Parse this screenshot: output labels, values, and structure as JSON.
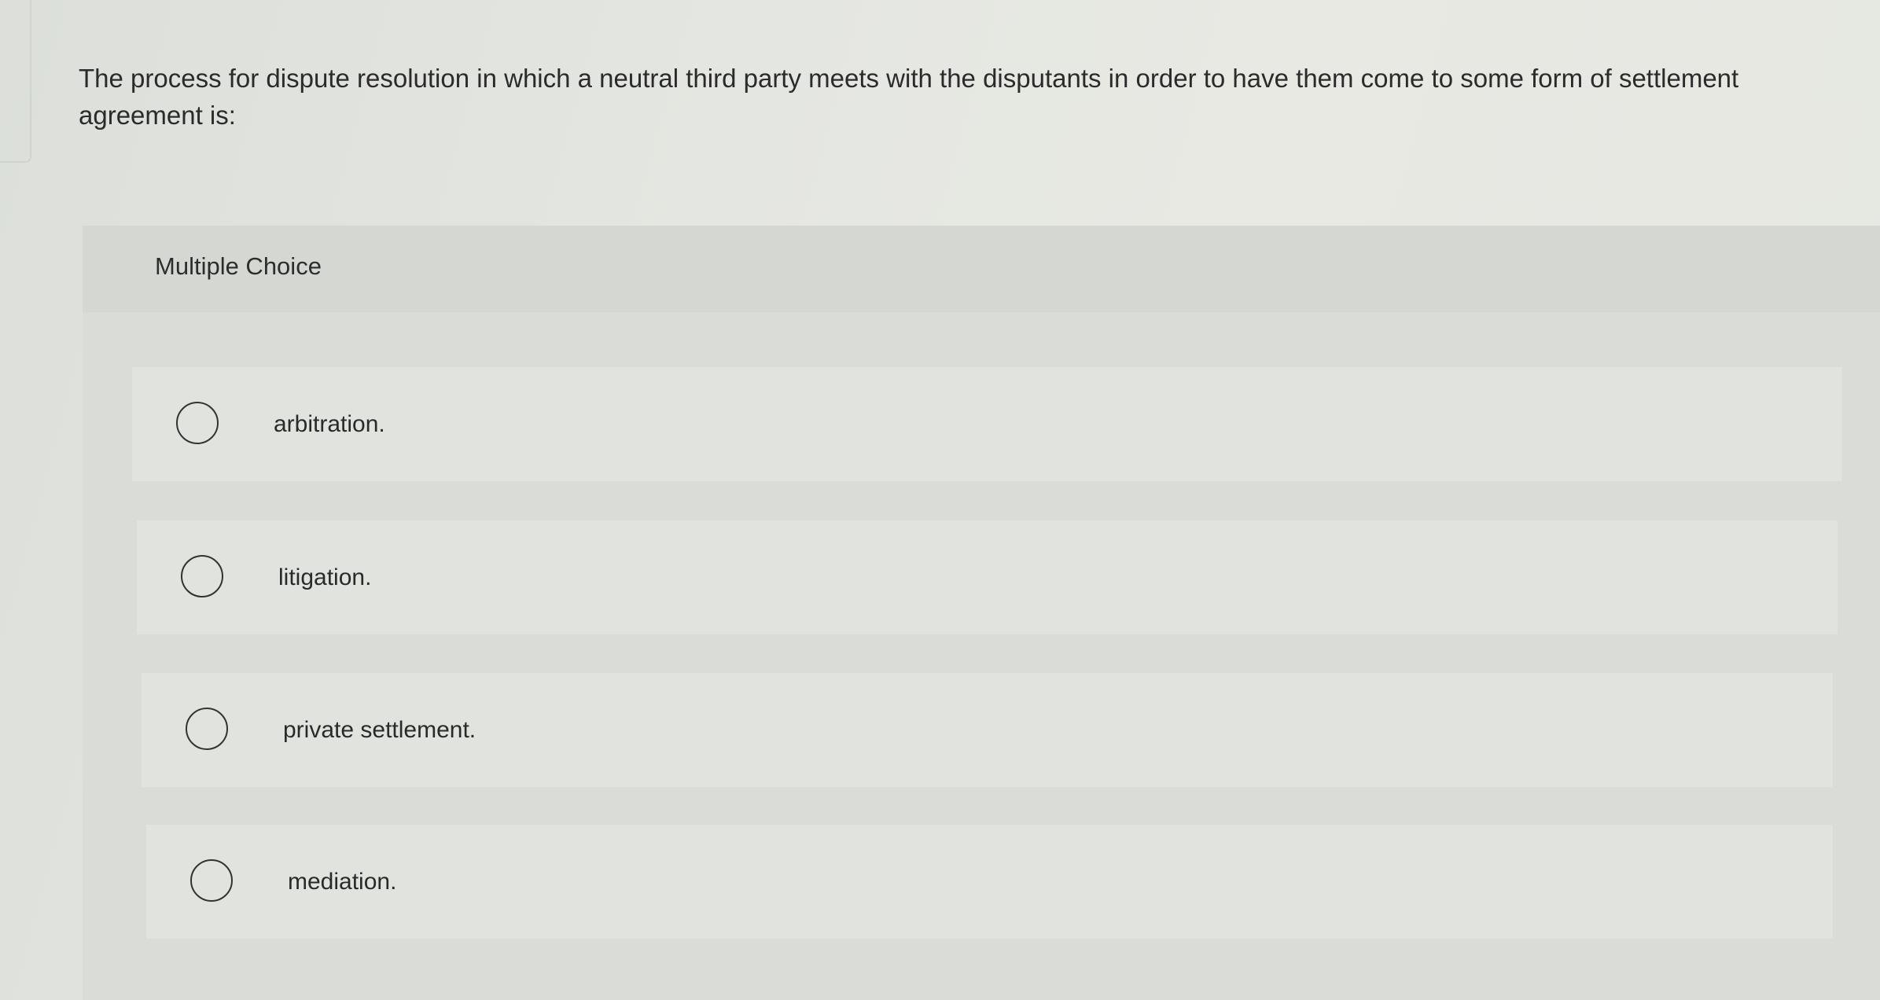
{
  "question": {
    "text": "The process for dispute resolution in which a neutral third party meets with the disputants in order to have them come to some form of settlement agreement is:"
  },
  "question_type": {
    "label": "Multiple Choice"
  },
  "options": [
    {
      "label": "arbitration.",
      "selected": false
    },
    {
      "label": "litigation.",
      "selected": false
    },
    {
      "label": "private settlement.",
      "selected": false
    },
    {
      "label": "mediation.",
      "selected": false
    }
  ],
  "colors": {
    "background": "#e4e6e1",
    "panel": "#d9dcd7",
    "option_background": "#e0e3de",
    "text": "#2a2a2a",
    "radio_border": "#333333"
  }
}
